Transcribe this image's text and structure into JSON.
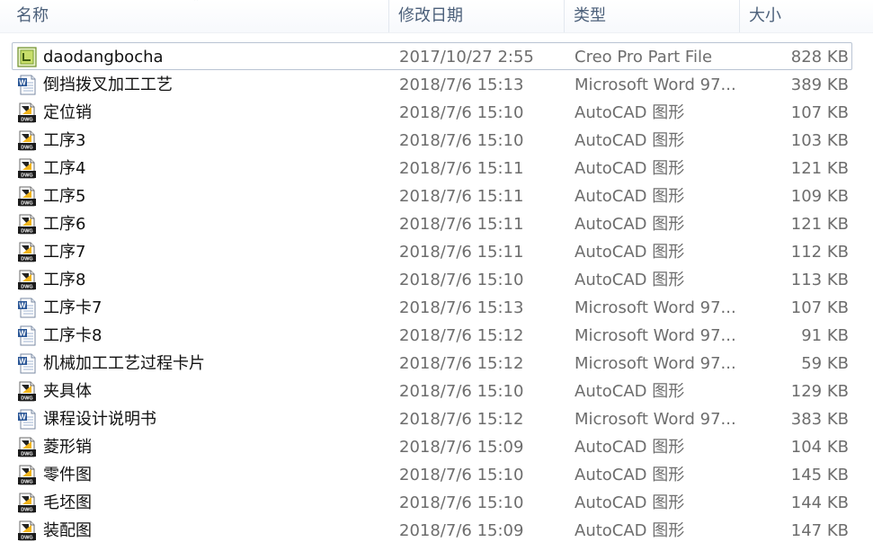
{
  "columns": {
    "name": "名称",
    "date": "修改日期",
    "type": "类型",
    "size": "大小"
  },
  "icons": {
    "creo": "creo-part-icon",
    "word": "word-document-icon",
    "dwg": "autocad-dwg-icon"
  },
  "icon_dwg_label": "DWG",
  "files": [
    {
      "name": "daodangbocha",
      "date": "2017/10/27 2:55",
      "type": "Creo Pro Part File",
      "size": "828 KB",
      "icon": "creo",
      "selected": true
    },
    {
      "name": "倒挡拨叉加工工艺",
      "date": "2018/7/6 15:13",
      "type": "Microsoft Word 97...",
      "size": "389 KB",
      "icon": "word"
    },
    {
      "name": "定位销",
      "date": "2018/7/6 15:10",
      "type": "AutoCAD 图形",
      "size": "107 KB",
      "icon": "dwg"
    },
    {
      "name": "工序3",
      "date": "2018/7/6 15:10",
      "type": "AutoCAD 图形",
      "size": "103 KB",
      "icon": "dwg"
    },
    {
      "name": "工序4",
      "date": "2018/7/6 15:11",
      "type": "AutoCAD 图形",
      "size": "121 KB",
      "icon": "dwg"
    },
    {
      "name": "工序5",
      "date": "2018/7/6 15:11",
      "type": "AutoCAD 图形",
      "size": "109 KB",
      "icon": "dwg"
    },
    {
      "name": "工序6",
      "date": "2018/7/6 15:11",
      "type": "AutoCAD 图形",
      "size": "121 KB",
      "icon": "dwg"
    },
    {
      "name": "工序7",
      "date": "2018/7/6 15:11",
      "type": "AutoCAD 图形",
      "size": "112 KB",
      "icon": "dwg"
    },
    {
      "name": "工序8",
      "date": "2018/7/6 15:10",
      "type": "AutoCAD 图形",
      "size": "113 KB",
      "icon": "dwg"
    },
    {
      "name": "工序卡7",
      "date": "2018/7/6 15:13",
      "type": "Microsoft Word 97...",
      "size": "107 KB",
      "icon": "word"
    },
    {
      "name": "工序卡8",
      "date": "2018/7/6 15:12",
      "type": "Microsoft Word 97...",
      "size": "91 KB",
      "icon": "word"
    },
    {
      "name": "机械加工工艺过程卡片",
      "date": "2018/7/6 15:12",
      "type": "Microsoft Word 97...",
      "size": "59 KB",
      "icon": "word"
    },
    {
      "name": "夹具体",
      "date": "2018/7/6 15:10",
      "type": "AutoCAD 图形",
      "size": "129 KB",
      "icon": "dwg"
    },
    {
      "name": "课程设计说明书",
      "date": "2018/7/6 15:12",
      "type": "Microsoft Word 97...",
      "size": "383 KB",
      "icon": "word"
    },
    {
      "name": "菱形销",
      "date": "2018/7/6 15:09",
      "type": "AutoCAD 图形",
      "size": "104 KB",
      "icon": "dwg"
    },
    {
      "name": "零件图",
      "date": "2018/7/6 15:10",
      "type": "AutoCAD 图形",
      "size": "145 KB",
      "icon": "dwg"
    },
    {
      "name": "毛坯图",
      "date": "2018/7/6 15:10",
      "type": "AutoCAD 图形",
      "size": "144 KB",
      "icon": "dwg"
    },
    {
      "name": "装配图",
      "date": "2018/7/6 15:09",
      "type": "AutoCAD 图形",
      "size": "147 KB",
      "icon": "dwg"
    }
  ]
}
